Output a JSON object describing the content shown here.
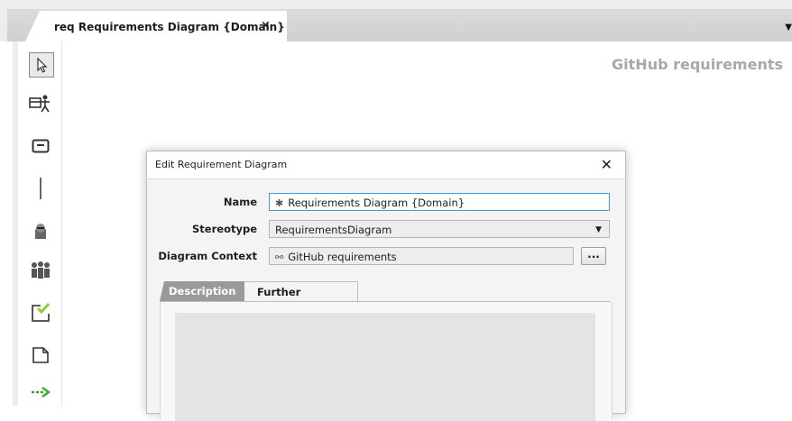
{
  "tab": {
    "label": "req Requirements Diagram {Domain}",
    "close": "×",
    "menu": "▼"
  },
  "toolbar": {
    "tools": [
      {
        "icon": "pointer-icon"
      },
      {
        "icon": "block-actor-icon"
      },
      {
        "icon": "rectangle-icon"
      },
      {
        "icon": "separator-line-icon"
      },
      {
        "icon": "actor-icon"
      },
      {
        "icon": "group-icon"
      },
      {
        "icon": "requirement-check-icon",
        "color": "#8ccf2e"
      },
      {
        "icon": "note-icon"
      },
      {
        "icon": "dependency-arrow-icon",
        "color": "#3aa52c"
      }
    ]
  },
  "canvas": {
    "title": "GitHub requirements"
  },
  "dialog": {
    "title": "Edit Requirement Diagram",
    "close": "✕",
    "fields": {
      "name_label": "Name",
      "name_value": "Requirements Diagram {Domain}",
      "name_icon": "✱",
      "stereotype_label": "Stereotype",
      "stereotype_value": "RequirementsDiagram",
      "context_label": "Diagram Context",
      "context_value": "GitHub requirements",
      "context_icon": "⚯",
      "browse": "..."
    },
    "tabs": [
      {
        "label": "Description",
        "active": true
      },
      {
        "label": "Further Properties",
        "active": false
      }
    ]
  }
}
